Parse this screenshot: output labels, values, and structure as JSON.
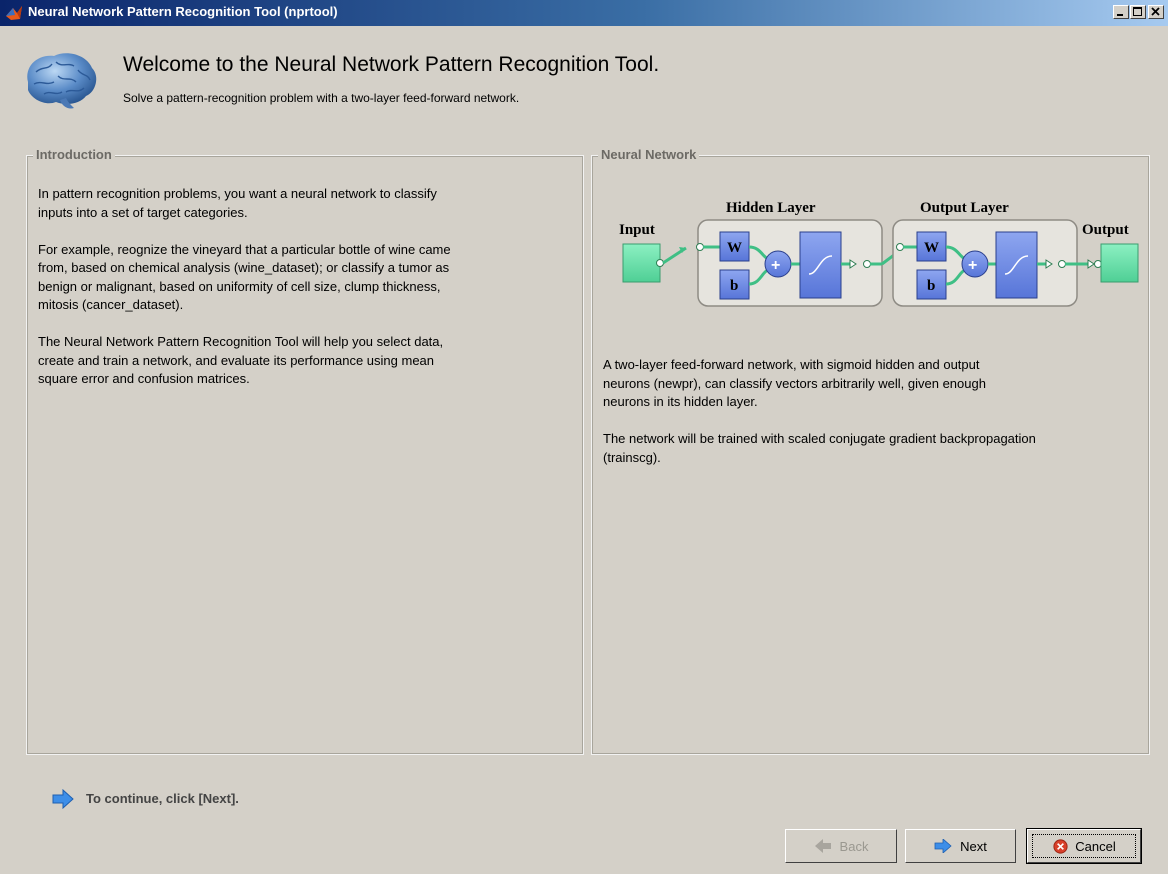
{
  "window": {
    "title": "Neural Network Pattern Recognition Tool (nprtool)",
    "app_icon": "matlab-logo-icon",
    "controls": [
      "minimize-icon",
      "maximize-icon",
      "close-icon"
    ]
  },
  "header": {
    "icon": "brain-icon",
    "title": "Welcome to the Neural Network Pattern Recognition Tool.",
    "subtitle": "Solve a pattern-recognition problem with a two-layer feed-forward network."
  },
  "introduction": {
    "title": "Introduction",
    "paragraphs": [
      [
        "In pattern recognition problems, you want a neural network to classify",
        "inputs into a set of target categories."
      ],
      [
        "For example, reognize the vineyard that a particular bottle of wine came",
        "from, based on chemical analysis (wine_dataset); or classify a tumor as",
        "benign or malignant, based on uniformity of cell size, clump thickness,",
        "mitosis (cancer_dataset)."
      ],
      [
        "The Neural Network Pattern Recognition Tool will help you select data,",
        "create and train a network, and evaluate its performance using mean",
        "square error and confusion matrices."
      ]
    ]
  },
  "neural_network": {
    "title": "Neural Network",
    "diagram": {
      "input_label": "Input",
      "hidden_label": "Hidden Layer",
      "output_layer_label": "Output Layer",
      "output_label": "Output",
      "weight_symbol": "W",
      "bias_symbol": "b",
      "sum_symbol": "+"
    },
    "paragraphs": [
      [
        "A two-layer feed-forward network, with sigmoid hidden and output",
        "neurons (newpr), can classify vectors arbitrarily well, given enough",
        "neurons in its hidden layer."
      ],
      [
        "The network will be trained with scaled conjugate gradient backpropagation",
        "(trainscg)."
      ]
    ]
  },
  "footer": {
    "hint_icon": "arrow-right-icon",
    "hint": "To continue, click [Next].",
    "back_label": "Back",
    "next_label": "Next",
    "cancel_label": "Cancel"
  },
  "colors": {
    "window_bg": "#d4d0c8",
    "title_start": "#0a246a",
    "title_end": "#a6caf0",
    "node_green": "#66e0a8",
    "block_blue": "#5f7de0",
    "arrow_blue": "#3d8ee8",
    "cancel_red": "#d8402a"
  }
}
